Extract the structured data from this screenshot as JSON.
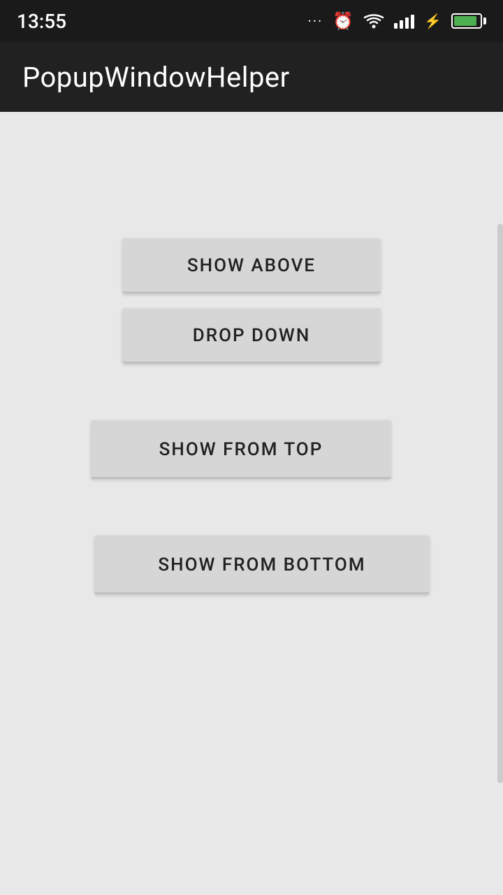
{
  "status_bar": {
    "time": "13:55",
    "dots": "...",
    "clock_symbol": "⏰",
    "wifi_symbol": "wifi",
    "signal_symbol": "signal",
    "lightning_symbol": "⚡"
  },
  "app_bar": {
    "title": "PopupWindowHelper"
  },
  "buttons": {
    "show_above": "SHOW ABOVE",
    "drop_down": "DROP DOWN",
    "show_from_top": "SHOW FROM TOP",
    "show_from_bottom": "SHOW FROM BOTTOM"
  }
}
